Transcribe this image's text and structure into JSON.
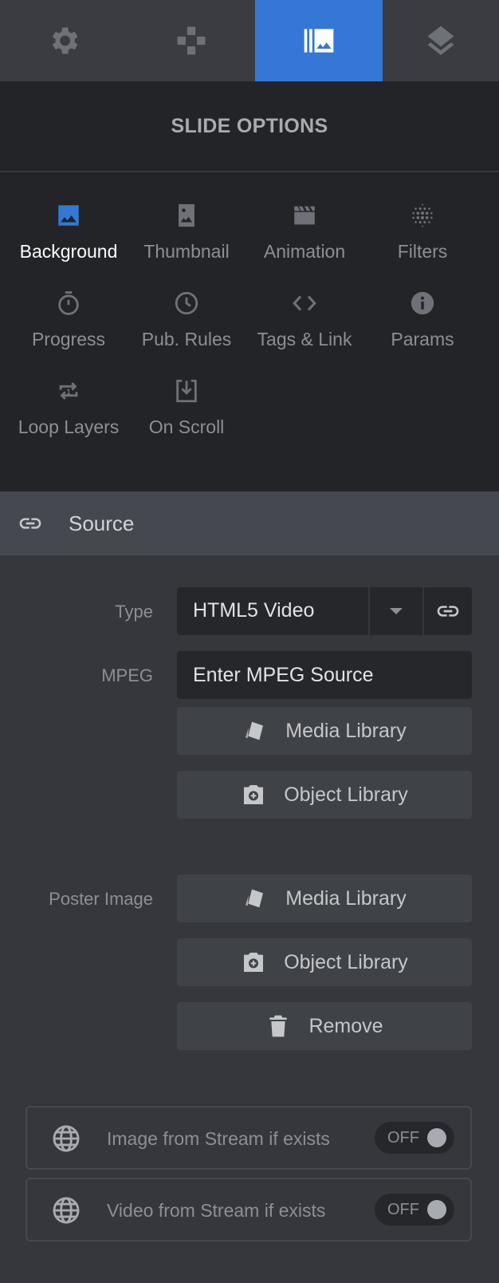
{
  "top_tabs": [
    {
      "icon": "gear-icon",
      "active": false
    },
    {
      "icon": "module-icon",
      "active": false
    },
    {
      "icon": "slide-gallery-icon",
      "active": true
    },
    {
      "icon": "layers-icon",
      "active": false
    }
  ],
  "header": {
    "title": "SLIDE OPTIONS"
  },
  "options": [
    {
      "label": "Background",
      "icon": "image-icon",
      "active": true
    },
    {
      "label": "Thumbnail",
      "icon": "portrait-image-icon"
    },
    {
      "label": "Animation",
      "icon": "clapperboard-icon"
    },
    {
      "label": "Filters",
      "icon": "dots-grid-icon"
    },
    {
      "label": "Progress",
      "icon": "timer-icon"
    },
    {
      "label": "Pub. Rules",
      "icon": "clock-icon"
    },
    {
      "label": "Tags & Link",
      "icon": "code-icon"
    },
    {
      "label": "Params",
      "icon": "info-icon"
    },
    {
      "label": "Loop Layers",
      "icon": "repeat-one-icon"
    },
    {
      "label": "On Scroll",
      "icon": "download-icon"
    }
  ],
  "section": {
    "title": "Source",
    "icon": "link-icon"
  },
  "form": {
    "type_label": "Type",
    "type_value": "HTML5 Video",
    "mpeg_label": "MPEG",
    "mpeg_placeholder": "Enter MPEG Source",
    "media_library": "Media Library",
    "object_library": "Object Library",
    "poster_label": "Poster Image",
    "remove": "Remove"
  },
  "toggles": [
    {
      "label": "Image from Stream if exists",
      "state": "OFF"
    },
    {
      "label": "Video from Stream if exists",
      "state": "OFF"
    }
  ],
  "colors": {
    "accent": "#3577d4",
    "panel_dark": "#232428",
    "panel": "#35373c"
  }
}
